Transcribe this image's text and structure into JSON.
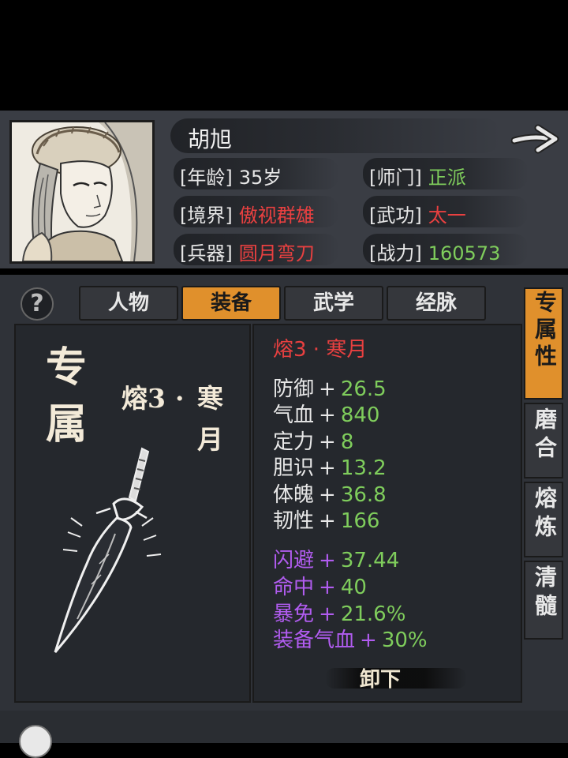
{
  "character": {
    "name": "胡旭",
    "stats": [
      {
        "label": "[年龄]",
        "value": "35岁",
        "color": "#e8e8e8"
      },
      {
        "label": "[师门]",
        "value": "正派",
        "color": "#7fcd5c"
      },
      {
        "label": "[境界]",
        "value": "傲视群雄",
        "color": "#e84040"
      },
      {
        "label": "[武功]",
        "value": "太一",
        "color": "#e84040"
      },
      {
        "label": "[兵器]",
        "value": "圆月弯刀",
        "color": "#e84040"
      },
      {
        "label": "[战力]",
        "value": "160573",
        "color": "#7fcd5c"
      }
    ]
  },
  "help_label": "?",
  "tabs": [
    "人物",
    "装备",
    "武学",
    "经脉"
  ],
  "active_tab": 1,
  "exclusive": {
    "big_label": [
      "专",
      "属"
    ],
    "weapon_name_col1": [
      "熔3",
      "·",
      "寒"
    ],
    "weapon_name_col2": [
      "月"
    ]
  },
  "equipment": {
    "title": "熔3 · 寒月",
    "title_color": "#e84040",
    "base_props": [
      {
        "name": "防御",
        "value": "26.5"
      },
      {
        "name": "气血",
        "value": "840"
      },
      {
        "name": "定力",
        "value": "8"
      },
      {
        "name": "胆识",
        "value": "13.2"
      },
      {
        "name": "体魄",
        "value": "36.8"
      },
      {
        "name": "韧性",
        "value": "166"
      }
    ],
    "extra_props": [
      {
        "name": "闪避",
        "value": "37.44"
      },
      {
        "name": "命中",
        "value": "40"
      },
      {
        "name": "暴免",
        "value": "21.6%"
      },
      {
        "name": "装备气血",
        "value": "30%"
      }
    ],
    "plus_sign": "+",
    "unequip_label": "卸下"
  },
  "side_tabs": [
    {
      "label": "专属性",
      "active": true
    },
    {
      "label": "磨合",
      "active": false
    },
    {
      "label": "熔炼",
      "active": false
    },
    {
      "label": "清髓",
      "active": false
    }
  ],
  "colors": {
    "accent": "#e0902c",
    "positive": "#7fcd5c",
    "rare": "#e84040",
    "special": "#b15cf0"
  }
}
